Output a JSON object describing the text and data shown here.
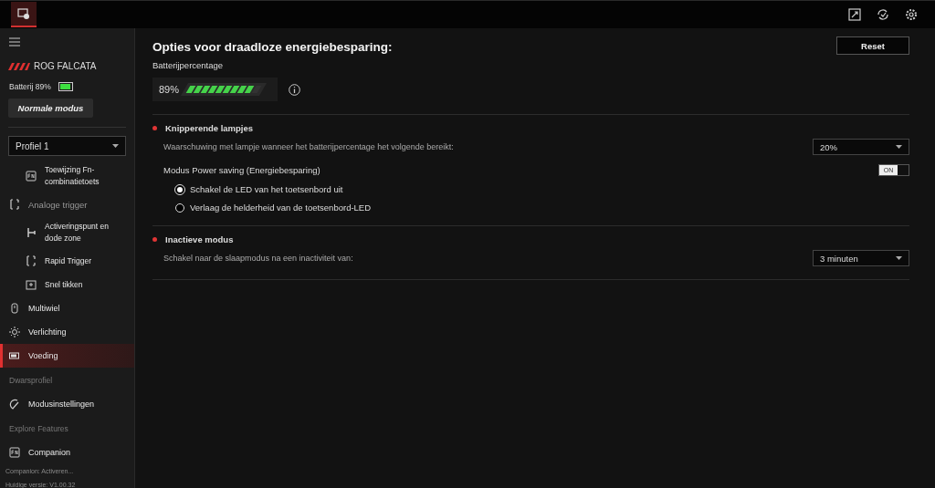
{
  "device": {
    "name": "ROG FALCATA",
    "battery": "Batterij 89%",
    "battery_icon": {
      "level": 0.89
    },
    "mode_button": "Normale modus"
  },
  "profile": {
    "value": "Profiel 1"
  },
  "sidebar": {
    "items": [
      {
        "kind": "sub",
        "label": "Toewijzing Fn-combinatietoets",
        "selected": false
      },
      {
        "kind": "group",
        "label": "Analoge trigger",
        "children": [
          {
            "kind": "sub",
            "label": "Activeringspunt en dode zone",
            "selected": false
          },
          {
            "kind": "sub",
            "label": "Rapid Trigger",
            "selected": false
          },
          {
            "kind": "sub",
            "label": "Snel tikken",
            "selected": false
          }
        ]
      },
      {
        "kind": "main",
        "label": "Multiwiel",
        "selected": false
      },
      {
        "kind": "main",
        "label": "Verlichting",
        "selected": false
      },
      {
        "kind": "main",
        "label": "Voeding",
        "selected": true
      },
      {
        "kind": "heading",
        "label": "Dwarsprofiel"
      },
      {
        "kind": "main",
        "label": "Modusinstellingen",
        "selected": false
      },
      {
        "kind": "heading",
        "label": "Explore Features"
      },
      {
        "kind": "main",
        "label": "Companion",
        "selected": false
      }
    ]
  },
  "footer": [
    "Companion: Activeren...",
    "Huidige versie: V1.00.32"
  ],
  "page": {
    "title": "Opties voor draadloze energiebesparing:",
    "reset_button": "Reset",
    "battery_label": "Batterijpercentage",
    "battery_reading": "89%",
    "battery_meter": {
      "level": 0.89
    }
  },
  "sections": [
    {
      "title": "Knipperende lampjes",
      "description": "Waarschuwing met lampje wanneer het batterijpercentage het volgende bereikt:",
      "dropdown": "20%",
      "power_saving": {
        "label": "Modus Power saving (Energiebesparing)",
        "toggle": "ON",
        "on": true,
        "options": [
          {
            "label": "Schakel de LED van het toetsenbord uit",
            "selected": true
          },
          {
            "label": "Verlaag de helderheid van de toetsenbord-LED",
            "selected": false
          }
        ]
      }
    },
    {
      "title": "Inactieve modus",
      "description": "Schakel naar de slaapmodus na een inactiviteit van:",
      "dropdown": "3 minuten"
    }
  ]
}
